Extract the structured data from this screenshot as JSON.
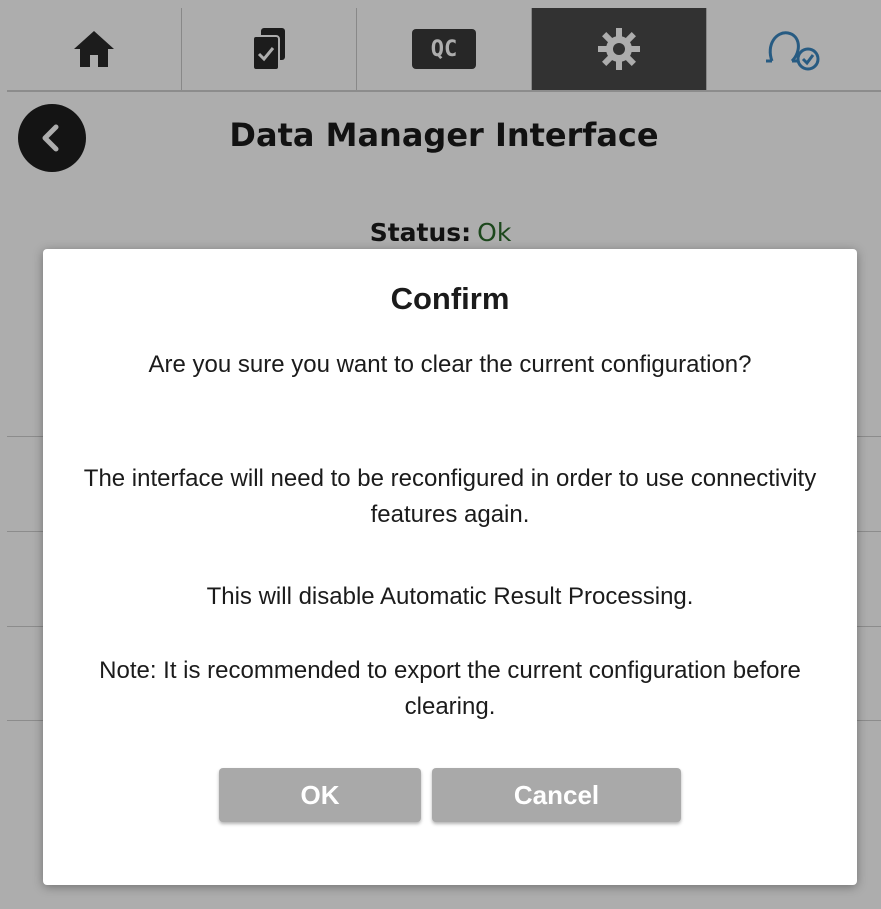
{
  "tabs": [
    {
      "icon": "home-icon",
      "label": ""
    },
    {
      "icon": "checklist-icon",
      "label": ""
    },
    {
      "icon": "qc-icon",
      "label": "QC"
    },
    {
      "icon": "gear-icon",
      "label": ""
    },
    {
      "icon": "user-check-icon",
      "label": ""
    }
  ],
  "active_tab": 3,
  "header": {
    "title": "Data Manager Interface",
    "back_icon": "back-arrow-icon"
  },
  "status": {
    "label": "Status:",
    "value": "Ok",
    "value_color": "#2c6a2c"
  },
  "dialog": {
    "title": "Confirm",
    "messages": [
      "Are you sure you want to clear the current configuration?",
      "The interface will need to be reconfigured in order to use connectivity features again.",
      "This will disable Automatic Result Processing.",
      "Note: It is recommended to export the current configuration before clearing."
    ],
    "ok_label": "OK",
    "cancel_label": "Cancel"
  },
  "colors": {
    "button_bg": "#a9a9a9",
    "active_tab_bg": "#4a4a4a",
    "user_icon": "#3a86c0"
  }
}
